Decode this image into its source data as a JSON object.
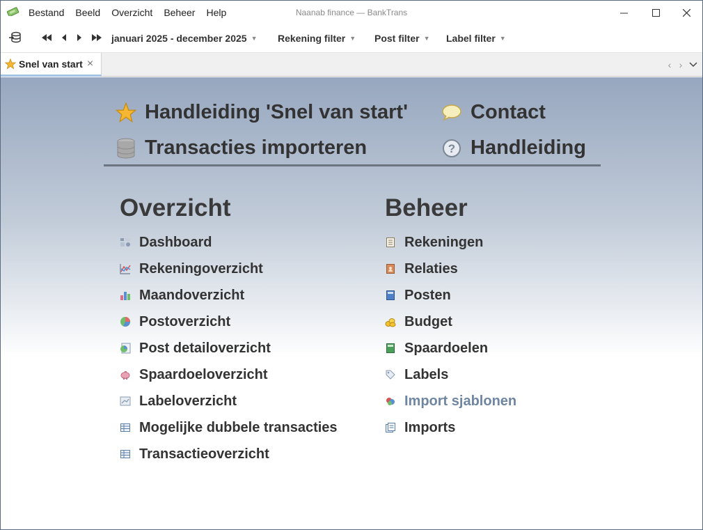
{
  "window": {
    "title": "Naanab finance — BankTrans",
    "minimize": "—",
    "maximize": "☐",
    "close": "✕"
  },
  "menu": [
    "Bestand",
    "Beeld",
    "Overzicht",
    "Beheer",
    "Help"
  ],
  "toolbar": {
    "period": "januari 2025 - december 2025",
    "filters": [
      "Rekening filter",
      "Post filter",
      "Label filter"
    ],
    "caret": "⌄"
  },
  "tab": {
    "label": "Snel van start",
    "close": "✕",
    "nav_prev": "‹",
    "nav_next": "›",
    "nav_menu": "⌄"
  },
  "quick_links": [
    {
      "label": "Handleiding 'Snel van start'",
      "icon": "star-icon"
    },
    {
      "label": "Contact",
      "icon": "speech-bubble-icon"
    },
    {
      "label": "Transacties importeren",
      "icon": "database-icon"
    },
    {
      "label": "Handleiding",
      "icon": "help-icon"
    }
  ],
  "overzicht": {
    "title": "Overzicht",
    "items": [
      {
        "label": "Dashboard",
        "icon": "dashboard-icon"
      },
      {
        "label": "Rekeningoverzicht",
        "icon": "line-chart-icon"
      },
      {
        "label": "Maandoverzicht",
        "icon": "bar-chart-icon"
      },
      {
        "label": "Postoverzicht",
        "icon": "pie-chart-icon"
      },
      {
        "label": "Post detailoverzicht",
        "icon": "pie-detail-icon"
      },
      {
        "label": "Spaardoeloverzicht",
        "icon": "piggy-bank-icon"
      },
      {
        "label": "Labeloverzicht",
        "icon": "label-chart-icon"
      },
      {
        "label": "Mogelijke dubbele transacties",
        "icon": "table-icon"
      },
      {
        "label": "Transactieoverzicht",
        "icon": "table-icon"
      }
    ]
  },
  "beheer": {
    "title": "Beheer",
    "items": [
      {
        "label": "Rekeningen",
        "icon": "ledger-icon",
        "muted": false
      },
      {
        "label": "Relaties",
        "icon": "address-book-icon",
        "muted": false
      },
      {
        "label": "Posten",
        "icon": "blue-book-icon",
        "muted": false
      },
      {
        "label": "Budget",
        "icon": "coins-icon",
        "muted": false
      },
      {
        "label": "Spaardoelen",
        "icon": "green-book-icon",
        "muted": false
      },
      {
        "label": "Labels",
        "icon": "tag-icon",
        "muted": false
      },
      {
        "label": "Import sjablonen",
        "icon": "import-template-icon",
        "muted": true
      },
      {
        "label": "Imports",
        "icon": "imports-icon",
        "muted": false
      }
    ]
  },
  "colors": {
    "accent_tab": "#a5c3e2",
    "muted_link": "#6f86a2",
    "gradient_top": "#97a7bf"
  }
}
